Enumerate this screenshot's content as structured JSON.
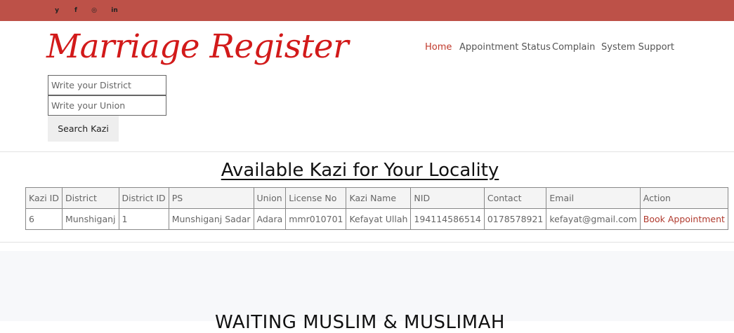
{
  "colors": {
    "topbar": "#bd5148",
    "brand_red": "#d21a1a",
    "active_nav": "#c0392b"
  },
  "social": [
    {
      "name": "twitter-icon",
      "glyph": "y"
    },
    {
      "name": "facebook-icon",
      "glyph": "f"
    },
    {
      "name": "instagram-icon",
      "glyph": "◎"
    },
    {
      "name": "linkedin-icon",
      "glyph": "in"
    }
  ],
  "logo": {
    "text": "Marriage Register"
  },
  "nav": {
    "home": "Home",
    "appointment_status": "Appointment Status",
    "complain": "Complain",
    "system_support": "System Support"
  },
  "search": {
    "district_placeholder": "Write your District",
    "union_placeholder": "Write your Union",
    "button": "Search Kazi"
  },
  "section_title": "Available Kazi for Your Locality",
  "table": {
    "headers": [
      "Kazi ID",
      "District",
      "District ID",
      "PS",
      "Union",
      "License No",
      "Kazi Name",
      "NID",
      "Contact",
      "Email",
      "Action"
    ],
    "rows": [
      [
        "6",
        "Munshiganj",
        "1",
        "Munshiganj Sadar",
        "Adara",
        "mmr010701",
        "Kefayat Ullah",
        "194114586514",
        "0178578921",
        "kefayat@gmail.com",
        "Book Appointment"
      ]
    ]
  },
  "bottom_title": "WAITING MUSLIM & MUSLIMAH"
}
